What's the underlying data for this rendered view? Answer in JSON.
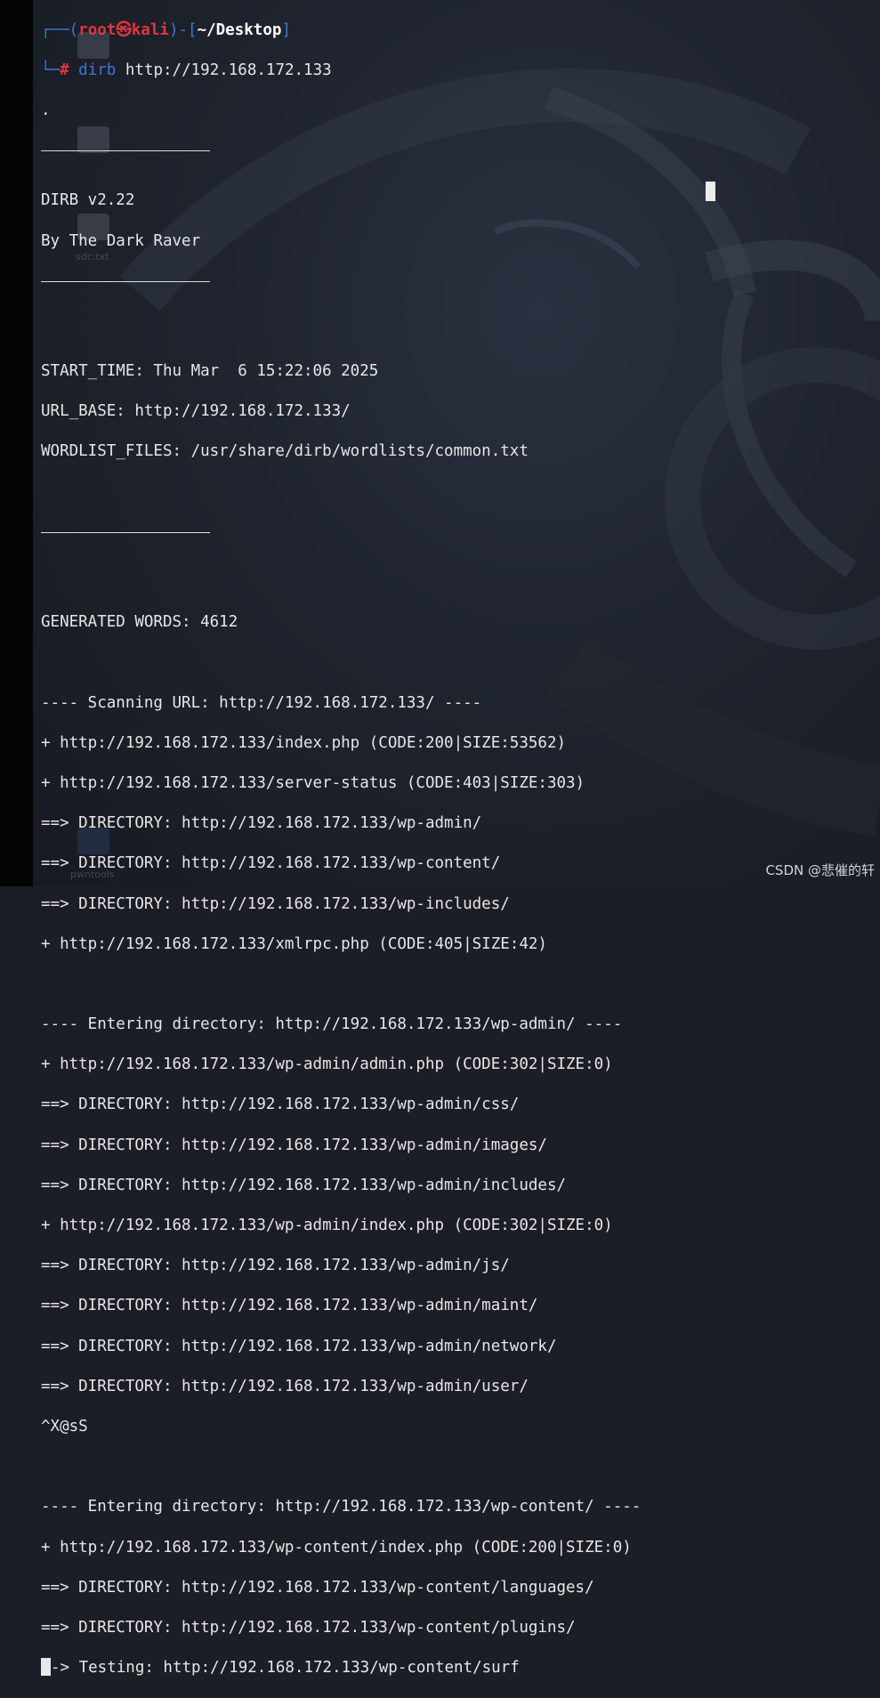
{
  "prompt": {
    "user": "root",
    "skull": "㉿",
    "host": "kali",
    "path": "~/Desktop",
    "hash": "#",
    "command": "dirb",
    "argument": "http://192.168.172.133"
  },
  "banner": {
    "dot": ".",
    "title": "DIRB v2.22",
    "author": "By The Dark Raver"
  },
  "scan_info": {
    "start_time": "START_TIME: Thu Mar  6 15:22:06 2025",
    "url_base": "URL_BASE: http://192.168.172.133/",
    "wordlist": "WORDLIST_FILES: /usr/share/dirb/wordlists/common.txt",
    "generated_words": "GENERATED WORDS: 4612"
  },
  "sections": [
    {
      "header": "---- Scanning URL: http://192.168.172.133/ ----",
      "lines": [
        "+ http://192.168.172.133/index.php (CODE:200|SIZE:53562)",
        "+ http://192.168.172.133/server-status (CODE:403|SIZE:303)",
        "==> DIRECTORY: http://192.168.172.133/wp-admin/",
        "==> DIRECTORY: http://192.168.172.133/wp-content/",
        "==> DIRECTORY: http://192.168.172.133/wp-includes/",
        "+ http://192.168.172.133/xmlrpc.php (CODE:405|SIZE:42)"
      ]
    },
    {
      "header": "---- Entering directory: http://192.168.172.133/wp-admin/ ----",
      "lines": [
        "+ http://192.168.172.133/wp-admin/admin.php (CODE:302|SIZE:0)",
        "==> DIRECTORY: http://192.168.172.133/wp-admin/css/",
        "==> DIRECTORY: http://192.168.172.133/wp-admin/images/",
        "==> DIRECTORY: http://192.168.172.133/wp-admin/includes/",
        "+ http://192.168.172.133/wp-admin/index.php (CODE:302|SIZE:0)",
        "==> DIRECTORY: http://192.168.172.133/wp-admin/js/",
        "==> DIRECTORY: http://192.168.172.133/wp-admin/maint/",
        "==> DIRECTORY: http://192.168.172.133/wp-admin/network/",
        "==> DIRECTORY: http://192.168.172.133/wp-admin/user/",
        "^X@sS"
      ]
    },
    {
      "header": "---- Entering directory: http://192.168.172.133/wp-content/ ----",
      "lines": [
        "+ http://192.168.172.133/wp-content/index.php (CODE:200|SIZE:0)",
        "==> DIRECTORY: http://192.168.172.133/wp-content/languages/",
        "==> DIRECTORY: http://192.168.172.133/wp-content/plugins/"
      ]
    }
  ],
  "progress_line": "-> Testing: http://192.168.172.133/wp-content/surf",
  "desktop_icons": [
    "sdc.txt",
    "pwntools"
  ],
  "watermark": "CSDN @悲催的轩",
  "colors": {
    "prompt_blue": "#3b79d6",
    "prompt_red": "#e5343d",
    "text": "#e6e6e6",
    "background": "#1b1e26"
  }
}
